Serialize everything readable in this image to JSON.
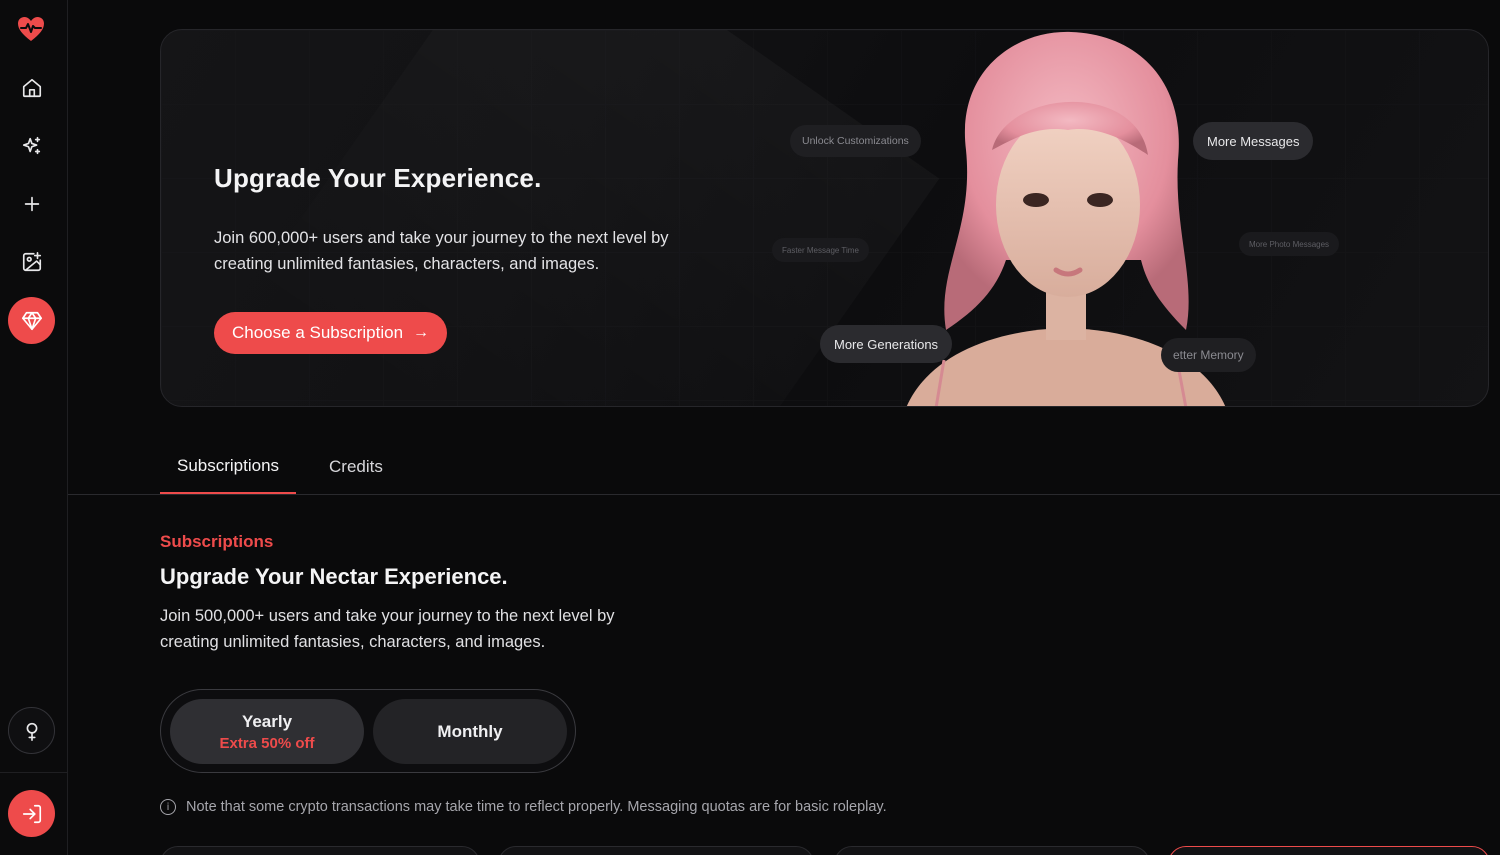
{
  "colors": {
    "accent": "#ee4b4b",
    "background": "#0a0a0b"
  },
  "sidebar": {
    "items": [
      {
        "name": "home",
        "icon": "home-icon"
      },
      {
        "name": "discover",
        "icon": "sparkles-icon"
      },
      {
        "name": "create",
        "icon": "plus-icon"
      },
      {
        "name": "generate-image",
        "icon": "image-plus-icon"
      },
      {
        "name": "premium",
        "icon": "gem-icon",
        "active": true
      }
    ],
    "bottom": [
      {
        "name": "gender",
        "icon": "female-symbol-icon"
      },
      {
        "name": "login",
        "icon": "login-icon"
      }
    ]
  },
  "hero": {
    "title": "Upgrade Your Experience.",
    "description": "Join 600,000+ users and take your journey to the next level by creating unlimited fantasies, characters, and images.",
    "cta_label": "Choose a Subscription",
    "chips": {
      "unlock": "Unlock Customizations",
      "messages": "More Messages",
      "faster": "Faster Message Time",
      "photos": "More Photo Messages",
      "generations": "More Generations",
      "memory": "etter Memory"
    }
  },
  "tabs": [
    {
      "label": "Subscriptions",
      "active": true
    },
    {
      "label": "Credits",
      "active": false
    }
  ],
  "section": {
    "eyebrow": "Subscriptions",
    "title": "Upgrade Your Nectar Experience.",
    "description": "Join 500,000+ users and take your journey to the next level by creating unlimited fantasies, characters, and images."
  },
  "billing_toggle": {
    "yearly_label": "Yearly",
    "yearly_discount": "Extra 50% off",
    "monthly_label": "Monthly",
    "selected": "yearly"
  },
  "note": "Note that some crypto transactions may take time to reflect properly. Messaging quotas are for basic roleplay."
}
